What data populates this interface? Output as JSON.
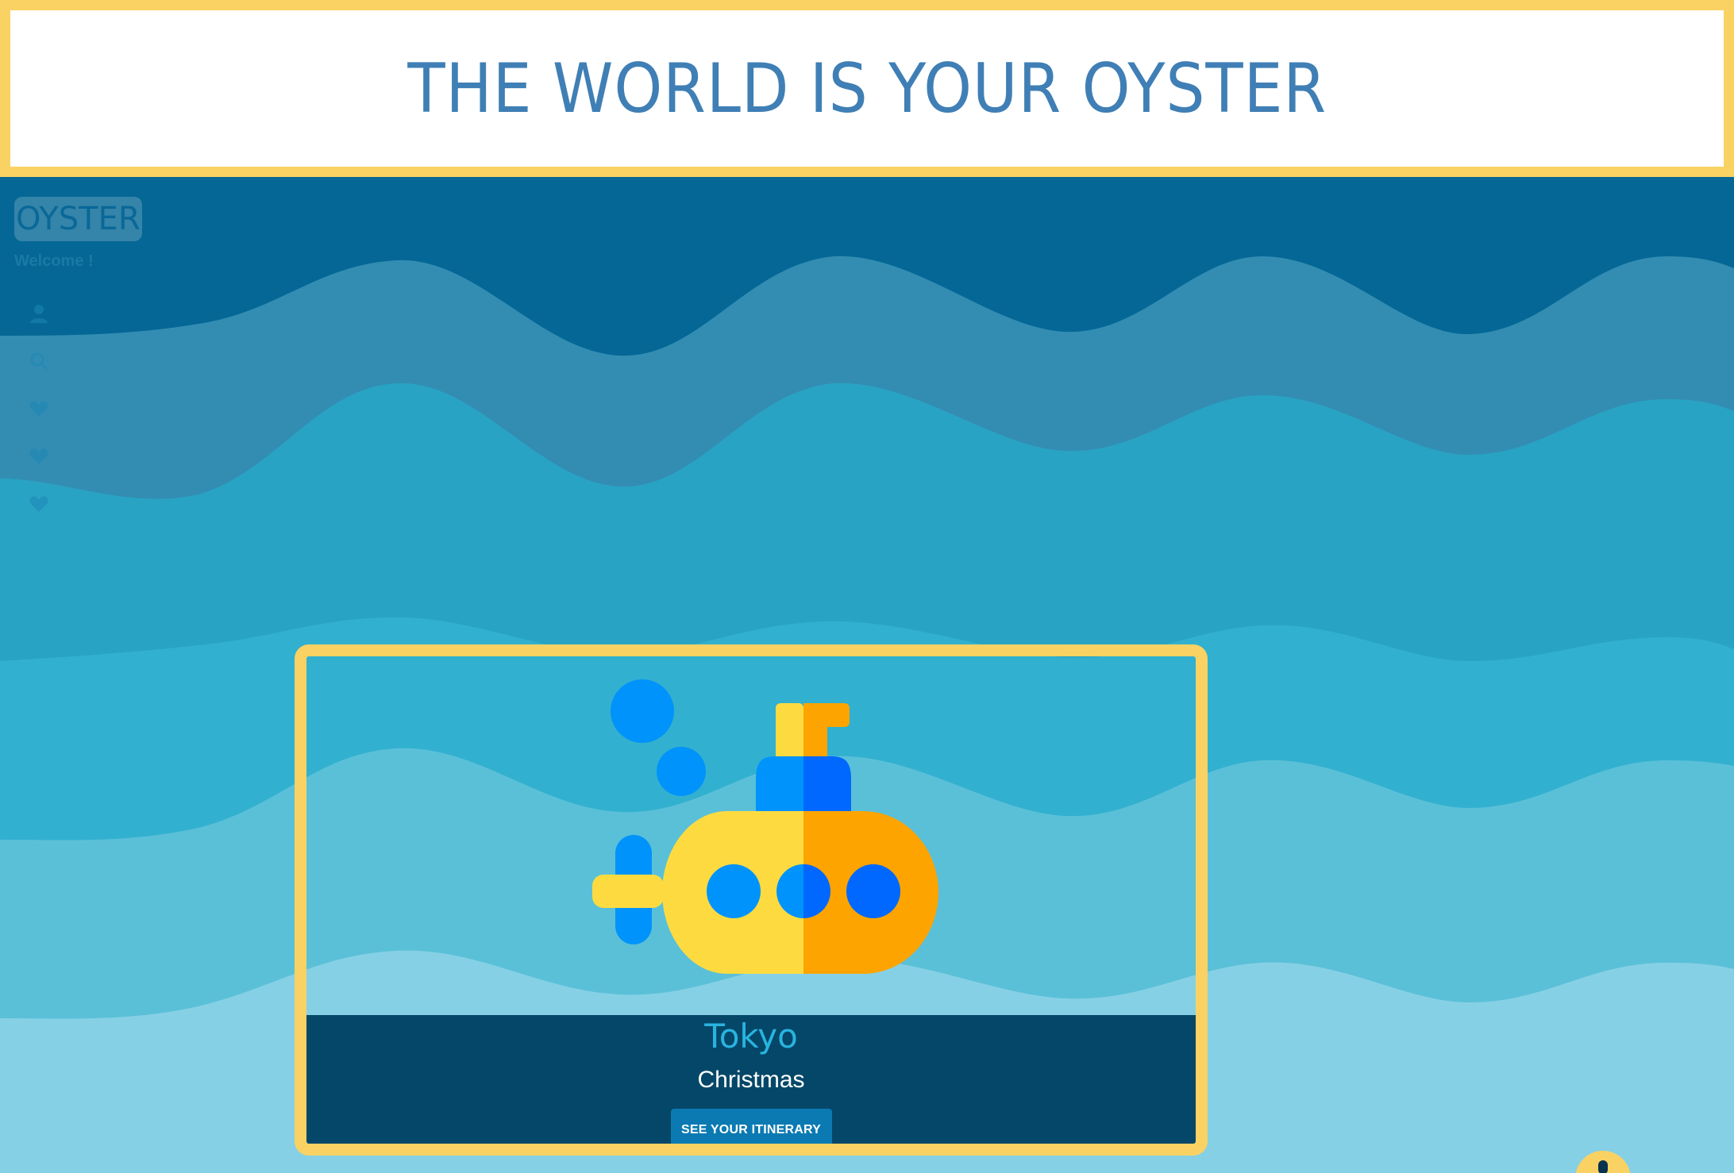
{
  "banner": {
    "title": "THE WORLD IS YOUR OYSTER"
  },
  "sidebar": {
    "brand": "OYSTER",
    "welcome": "Welcome !",
    "items": [
      {
        "icon": "user-icon"
      },
      {
        "icon": "search-icon"
      },
      {
        "icon": "heart-icon"
      },
      {
        "icon": "heart-icon"
      },
      {
        "icon": "heart-icon"
      }
    ]
  },
  "trip_card": {
    "image_icon": "submarine-icon",
    "city": "Tokyo",
    "trip_name": "Christmas",
    "button_label": "SEE YOUR ITINERARY"
  },
  "floating_button": {
    "icon": "info-icon"
  },
  "colors": {
    "accent": "#f9d263",
    "banner_text": "#3f7fb5",
    "caption_bg": "#054768",
    "city_text": "#29b4e0",
    "button_bg": "#0b7ab3",
    "wave_1": "#056795",
    "wave_2": "#338db2",
    "wave_3": "#29a3c4",
    "wave_4": "#32b0cf",
    "wave_5": "#5ac0d8",
    "wave_6": "#86d0e5"
  }
}
